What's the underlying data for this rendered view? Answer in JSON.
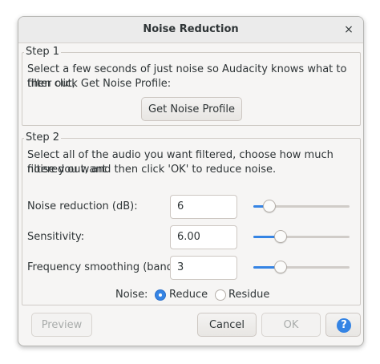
{
  "dialog": {
    "title": "Noise Reduction",
    "close_glyph": "×"
  },
  "step1": {
    "label": "Step 1",
    "description_line1": "Select a few seconds of just noise so Audacity knows what to filter out,",
    "description_line2": "then click Get Noise Profile:",
    "button_label": "Get Noise Profile"
  },
  "step2": {
    "label": "Step 2",
    "description_line1": "Select all of the audio you want filtered, choose how much noise you want",
    "description_line2": "filtered out, and then click 'OK' to reduce noise.",
    "params": [
      {
        "label": "Noise reduction (dB):",
        "value": "6",
        "slider_fraction": 0.12
      },
      {
        "label": "Sensitivity:",
        "value": "6.00",
        "slider_fraction": 0.25
      },
      {
        "label": "Frequency smoothing (bands):",
        "value": "3",
        "slider_fraction": 0.25
      }
    ],
    "noise_label": "Noise:",
    "noise_options": [
      {
        "label": "Reduce",
        "selected": true
      },
      {
        "label": "Residue",
        "selected": false
      }
    ]
  },
  "footer": {
    "preview_label": "Preview",
    "cancel_label": "Cancel",
    "ok_label": "OK",
    "help_glyph": "?"
  },
  "colors": {
    "accent": "#3584e4"
  }
}
